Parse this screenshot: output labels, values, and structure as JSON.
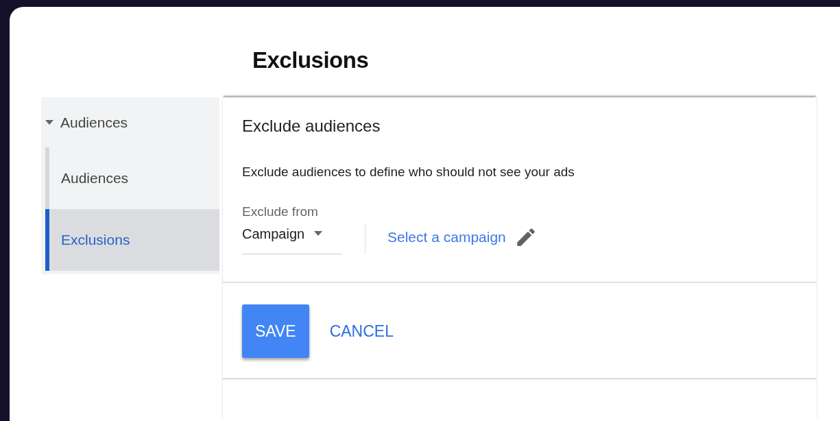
{
  "page_title": "Exclusions",
  "sidebar": {
    "items": [
      {
        "label": "Audiences",
        "expanded": true,
        "children": [
          {
            "label": "Audiences",
            "selected": false
          },
          {
            "label": "Exclusions",
            "selected": true
          }
        ]
      }
    ]
  },
  "panel": {
    "heading": "Exclude audiences",
    "description": "Exclude audiences to define who should not see your ads",
    "exclude_from": {
      "label": "Exclude from",
      "value": "Campaign"
    },
    "select_link": "Select a campaign"
  },
  "buttons": [
    {
      "label": "SAVE",
      "kind": "primary"
    },
    {
      "label": "CANCEL",
      "kind": "text"
    }
  ]
}
